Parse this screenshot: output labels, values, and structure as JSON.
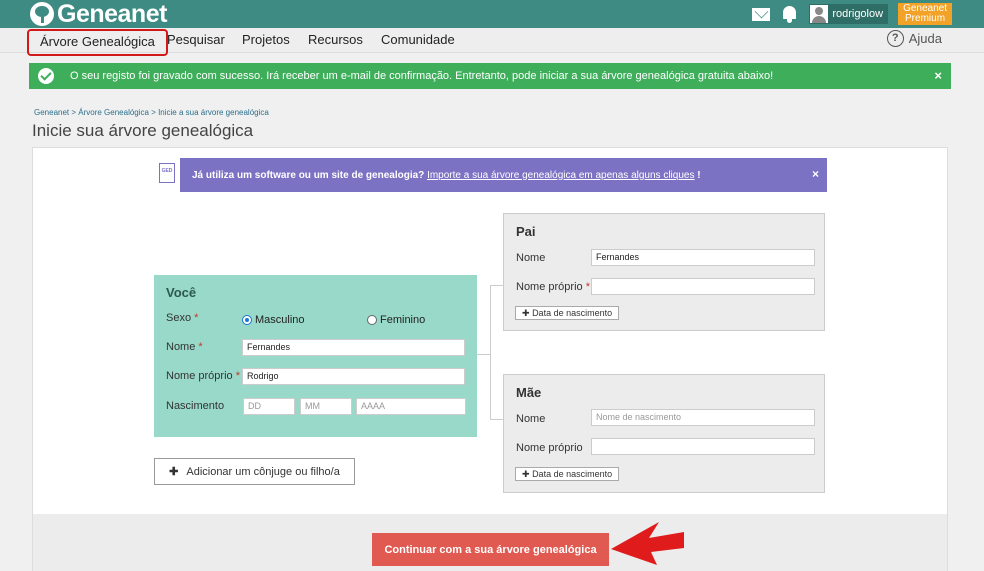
{
  "header": {
    "logo_text": "Geneanet",
    "username": "rodrigolow",
    "premium_line1": "Geneanet",
    "premium_line2": "Premium"
  },
  "nav": {
    "items": [
      "Árvore Genealógica",
      "Pesquisar",
      "Projetos",
      "Recursos",
      "Comunidade"
    ],
    "help_label": "Ajuda",
    "help_glyph": "?"
  },
  "alert": {
    "message": "O seu registo foi gravado com sucesso. Irá receber um e-mail de confirmação. Entretanto, pode iniciar a sua árvore genealógica gratuita abaixo!",
    "close": "×"
  },
  "breadcrumb": "Geneanet > Árvore Genealógica > Inicie a sua árvore genealógica",
  "page_title": "Inicie sua árvore genealógica",
  "import_banner": {
    "icon_text": "GED",
    "question": "Já utiliza um software ou um site de genealogia?",
    "link": "Importe a sua árvore genealógica em apenas alguns cliques",
    "suffix": " !",
    "close": "×"
  },
  "you": {
    "title": "Você",
    "sex_label": "Sexo",
    "male": "Masculino",
    "female": "Feminino",
    "selected_sex": "Masculino",
    "surname_label": "Nome",
    "surname_value": "Fernandes",
    "first_label": "Nome próprio",
    "first_value": "Rodrigo",
    "birth_label": "Nascimento",
    "day_placeholder": "DD",
    "month_placeholder": "MM",
    "year_placeholder": "AAAA",
    "required_mark": "*"
  },
  "father": {
    "title": "Pai",
    "surname_label": "Nome",
    "surname_value": "Fernandes",
    "first_label": "Nome próprio",
    "first_value": "",
    "birth_button": "Data de nascimento"
  },
  "mother": {
    "title": "Mãe",
    "surname_label": "Nome",
    "surname_placeholder": "Nome de nascimento",
    "first_label": "Nome próprio",
    "first_value": "",
    "birth_button": "Data de nascimento"
  },
  "add_button": "Adicionar um cônjuge ou filho/a",
  "continue_button": "Continuar com a sua árvore genealógica",
  "plus_glyph": "✚",
  "colors": {
    "topbar": "#3d8b82",
    "alert": "#3eae5b",
    "banner": "#7b72c4",
    "you_panel": "#98d9c9",
    "continue": "#e05a52",
    "premium": "#f1a227",
    "arrow": "#e01b1b"
  }
}
